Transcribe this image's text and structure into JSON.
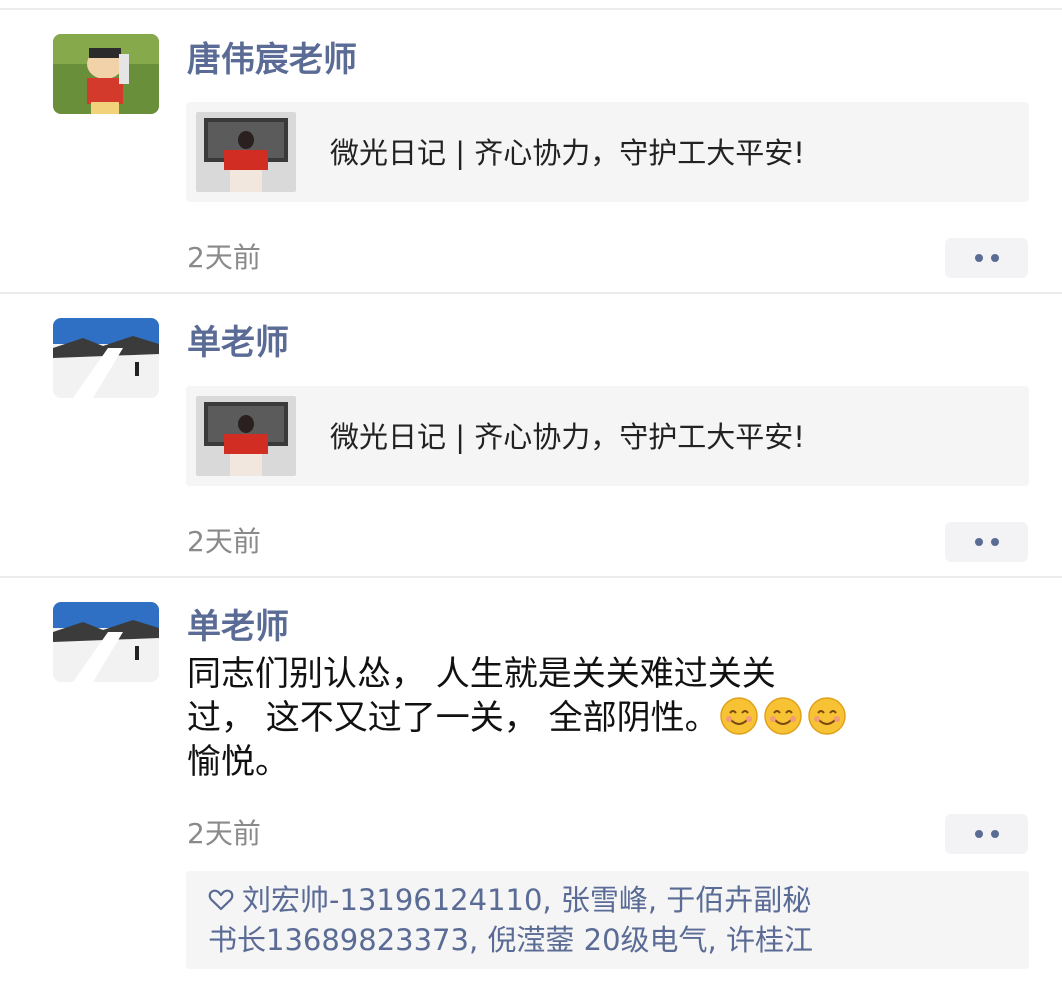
{
  "posts": [
    {
      "name": "唐伟宸老师",
      "share_title": "微光日记 | 齐心协力，守护工大平安!",
      "time": "2天前"
    },
    {
      "name": "单老师",
      "share_title": "微光日记 | 齐心协力，守护工大平安!",
      "time": "2天前"
    },
    {
      "name": "单老师",
      "content_line1": "同志们别认怂， 人生就是关关难过关关",
      "content_line2": "过， 这不又过了一关， 全部阴性。",
      "content_line3": "愉悦。",
      "emojis": [
        "smile-emoji",
        "smile-emoji",
        "smile-emoji"
      ],
      "time": "2天前",
      "likes_line1": "刘宏帅-13196124110, 张雪峰, 于佰卉副秘",
      "likes_line2": "书长13689823373, 倪滢蓥 20级电气, 许桂江"
    }
  ],
  "icons": {
    "more": "more-dots-icon",
    "like": "heart-outline-icon"
  },
  "colors": {
    "name": "#5a6b95",
    "time": "#8a8a8a",
    "card_bg": "#f5f5f5"
  }
}
